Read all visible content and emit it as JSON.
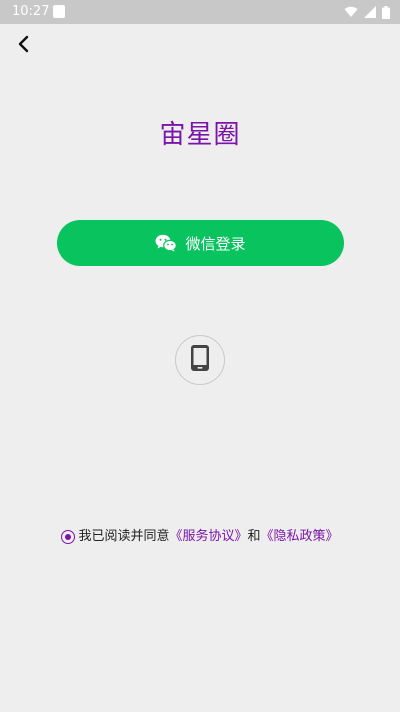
{
  "status_bar": {
    "time": "10:27",
    "icons": [
      "app-notification-icon",
      "wifi-icon",
      "signal-icon",
      "battery-icon"
    ]
  },
  "nav": {
    "back_icon": "chevron-left-icon"
  },
  "app": {
    "title": "宙星圈"
  },
  "login": {
    "wechat_label": "微信登录",
    "wechat_icon": "wechat-icon",
    "phone_icon": "phone-icon"
  },
  "agreement": {
    "prefix": "我已阅读并同意",
    "service_link": "《服务协议》",
    "conjunction": "和",
    "privacy_link": "《隐私政策》",
    "checked": true
  },
  "colors": {
    "background": "#eeeeee",
    "brand_purple": "#7b14a8",
    "wechat_green": "#09c35e",
    "status_bar": "#c8c8c8"
  }
}
